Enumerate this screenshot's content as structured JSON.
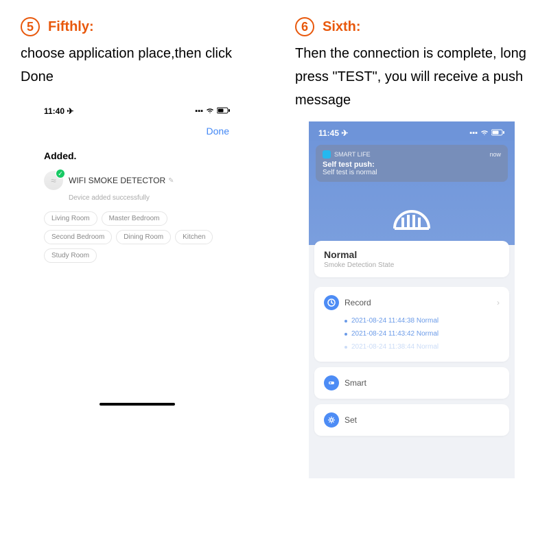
{
  "step5": {
    "num": "5",
    "title": "Fifthly:",
    "desc": "choose application place,then click Done"
  },
  "step6": {
    "num": "6",
    "title": "Sixth:",
    "desc": "Then the connection is complete, long press \"TEST\", you will receive a push message"
  },
  "left_phone": {
    "time": "11:40",
    "done": "Done",
    "added": "Added.",
    "device_name": "WIFI  SMOKE DETECTOR",
    "device_sub": "Device added successfully",
    "chips": [
      "Living Room",
      "Master Bedroom",
      "Second Bedroom",
      "Dining Room",
      "Kitchen",
      "Study Room"
    ]
  },
  "right_phone": {
    "time": "11:45",
    "notif": {
      "app": "SMART LIFE",
      "when": "now",
      "title": "Self test push:",
      "body": "Self test is normal"
    },
    "status": {
      "title": "Normal",
      "sub": "Smoke Detection State"
    },
    "record_label": "Record",
    "records": [
      "2021-08-24 11:44:38 Normal",
      "2021-08-24 11:43:42 Normal",
      "2021-08-24 11:38:44 Normal"
    ],
    "smart_label": "Smart",
    "set_label": "Set"
  }
}
